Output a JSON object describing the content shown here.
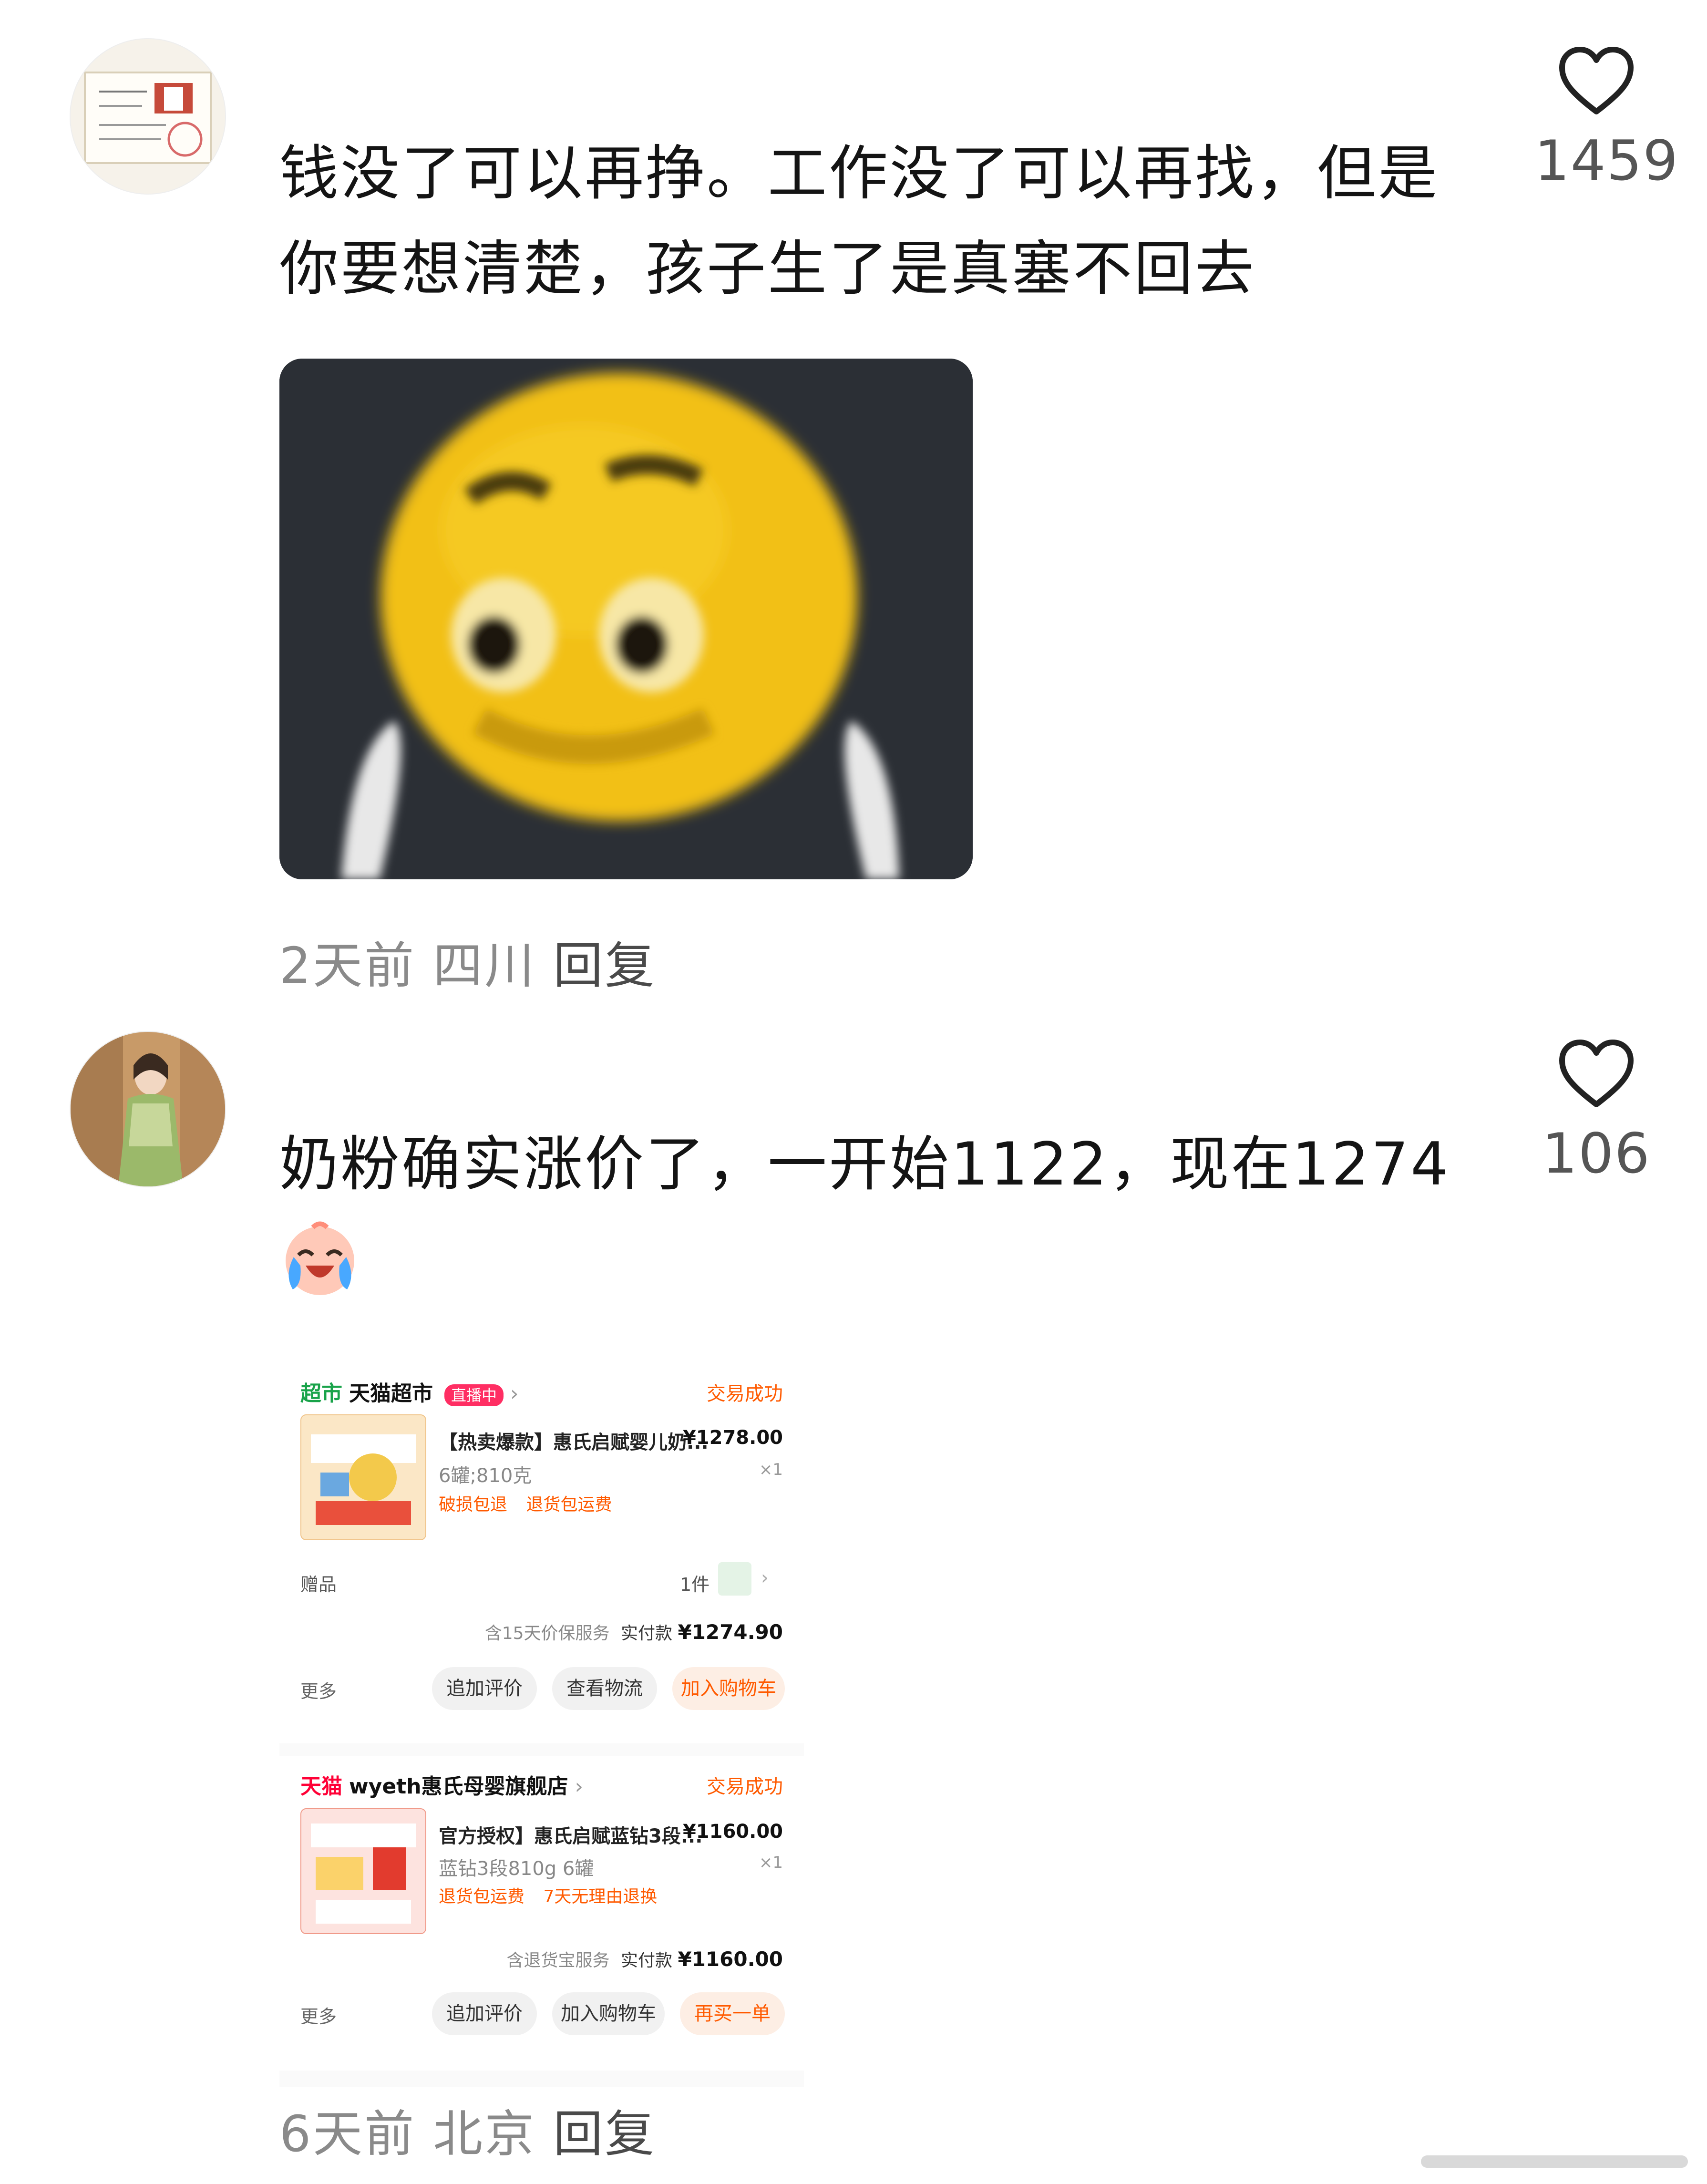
{
  "comments": [
    {
      "text_line1": "钱没了可以再挣。工作没了可以再找，但是",
      "text_line2": "你要想清楚，孩子生了是真塞不回去",
      "likes": "1459",
      "time": "2天前",
      "location": "四川",
      "reply_label": "回复",
      "avatar_icon": "certificate-avatar",
      "attached_image": "crying-yellow-emoji-meme"
    },
    {
      "text_line1": "奶粉确实涨价了，一开始1122，现在1274",
      "emoji_icon": "crying-laughing-emoji",
      "likes": "106",
      "time": "6天前",
      "location": "北京",
      "reply_label": "回复",
      "avatar_icon": "user-photo-avatar",
      "orders": [
        {
          "store_tag": "超市",
          "store_name": "天猫超市",
          "live_badge": "直播中",
          "status": "交易成功",
          "product_title": "【热卖爆款】惠氏启赋婴儿奶...",
          "price": "¥1278.00",
          "spec": "6罐;810克",
          "quantity": "×1",
          "service_tags": [
            "破损包退",
            "退货包运费"
          ],
          "gift_label": "赠品",
          "gift_count": "1件",
          "payment_note": "含15天价保服务",
          "paid_label": "实付款",
          "paid_amount": "¥1274.90",
          "more_label": "更多",
          "actions": [
            "追加评价",
            "查看物流",
            "加入购物车"
          ]
        },
        {
          "store_tag": "天猫",
          "store_name": "wyeth惠氏母婴旗舰店",
          "status": "交易成功",
          "product_title": "官方授权】惠氏启赋蓝钻3段...",
          "price": "¥1160.00",
          "spec": "蓝钻3段810g 6罐",
          "quantity": "×1",
          "service_tags": [
            "退货包运费",
            "7天无理由退换"
          ],
          "payment_note": "含退货宝服务",
          "paid_label": "实付款",
          "paid_amount": "¥1160.00",
          "more_label": "更多",
          "actions": [
            "追加评价",
            "加入购物车",
            "再买一单"
          ]
        }
      ]
    }
  ],
  "colors": {
    "accent_orange": "#ff5a00",
    "tmall_red": "#ff0036",
    "meta_gray": "#8a8a8a",
    "emoji_yellow": "#f3c21a"
  },
  "icons": {
    "like": "heart-outline-icon"
  }
}
